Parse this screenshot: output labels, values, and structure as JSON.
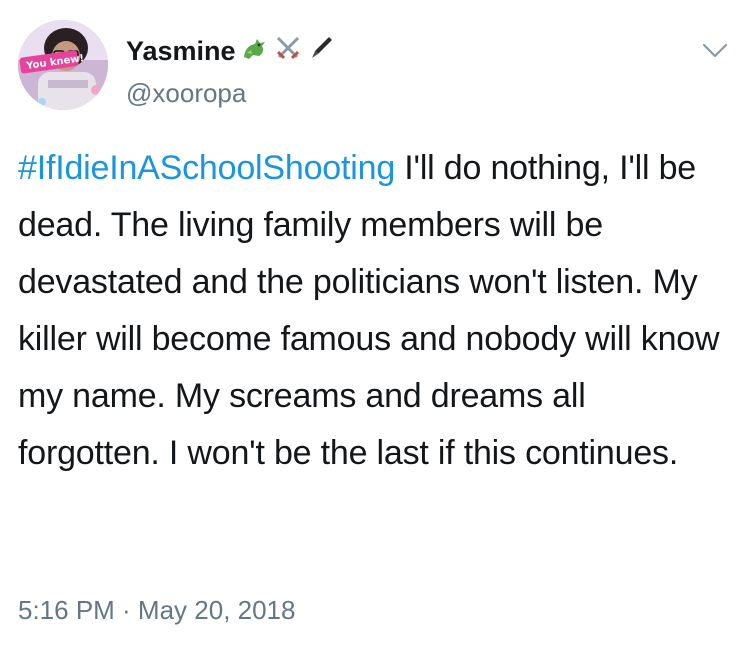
{
  "tweet": {
    "author": {
      "display_name": "Yasmine",
      "handle": "@xooropa",
      "name_emojis": [
        "dragon-emoji",
        "crossed-swords-emoji",
        "pen-emoji"
      ],
      "avatar_caption": "You knew!"
    },
    "text_hashtag": "#IfIdieInASchoolShooting",
    "text_body": " I'll do nothing, I'll be dead. The living family members will be devastated and the politicians won't listen. My killer will become famous and nobody will know my name. My screams and dreams all forgotten. I won't be the last if this continues.",
    "timestamp": "5:16 PM · May 20, 2018"
  },
  "colors": {
    "link": "#1b95e0",
    "text": "#14171a",
    "muted": "#657786"
  }
}
